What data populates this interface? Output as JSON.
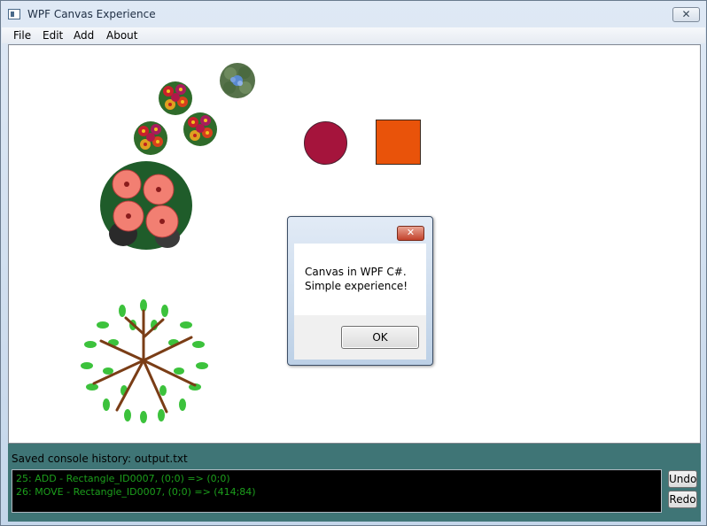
{
  "window": {
    "title": "WPF Canvas Experience",
    "close_symbol": "✕"
  },
  "menu": {
    "items": [
      "File",
      "Edit",
      "Add",
      "About"
    ]
  },
  "status": {
    "saved_text": "Saved console history: output.txt"
  },
  "console": {
    "lines": [
      "25: ADD - Rectangle_ID0007, (0;0) => (0;0)",
      "26: MOVE - Rectangle_ID0007, (0;0) => (414;84)"
    ]
  },
  "buttons": {
    "undo": "Undo",
    "redo": "Redo"
  },
  "dialog": {
    "line1": "Canvas in WPF C#.",
    "line2": "Simple experience!",
    "ok": "OK",
    "close_symbol": "✕"
  },
  "colors": {
    "circle": "#a5143c",
    "rectangle": "#e9530a",
    "console_text": "#1c9e1c",
    "panel": "#3f7576"
  }
}
